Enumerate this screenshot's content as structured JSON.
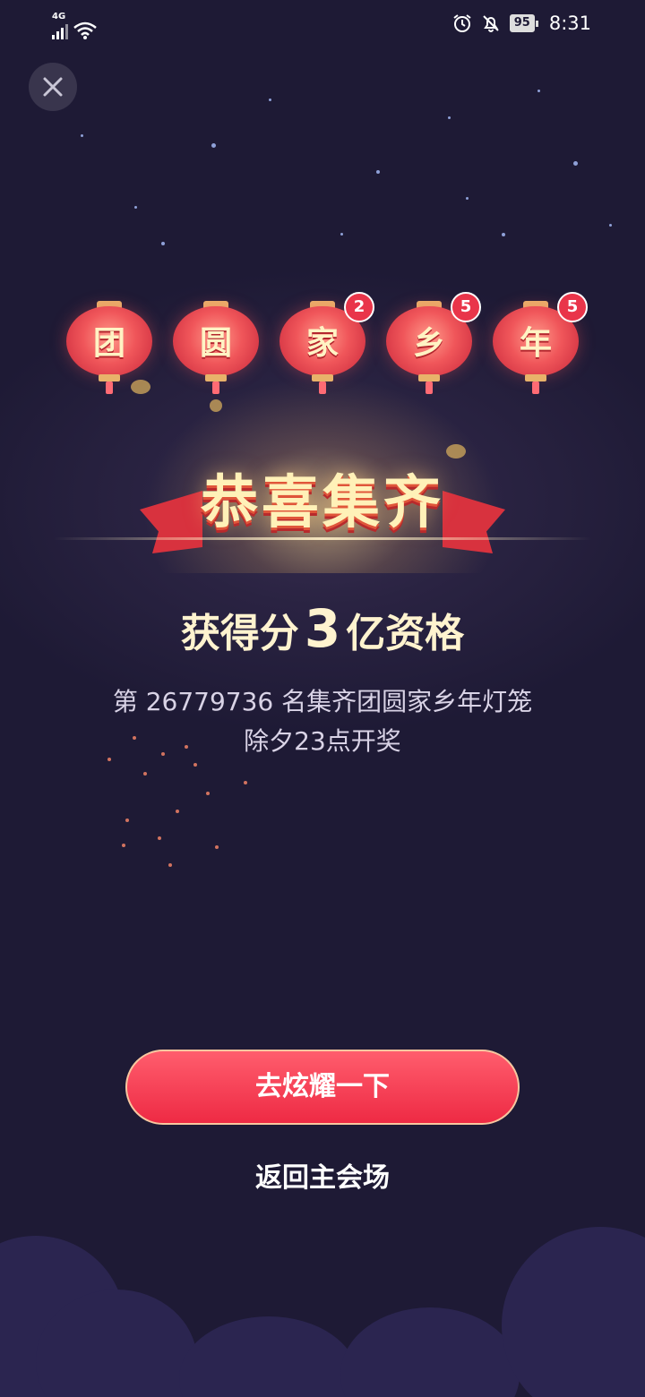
{
  "status_bar": {
    "network": "4G",
    "battery": "95",
    "time": "8:31"
  },
  "lanterns": [
    {
      "char": "团",
      "badge": ""
    },
    {
      "char": "圆",
      "badge": ""
    },
    {
      "char": "家",
      "badge": "2"
    },
    {
      "char": "乡",
      "badge": "5"
    },
    {
      "char": "年",
      "badge": "5"
    }
  ],
  "banner": {
    "title": "恭喜集齐"
  },
  "prize": {
    "prefix": "获得分",
    "number": "3",
    "suffix": "亿资格"
  },
  "info": {
    "line1": "第 26779736 名集齐团圆家乡年灯笼",
    "line2": "除夕23点开奖"
  },
  "actions": {
    "primary_label": "去炫耀一下",
    "secondary_label": "返回主会场"
  },
  "colors": {
    "background": "#1c1834",
    "accent": "#ee2a44",
    "gold_text": "#fff3cf"
  }
}
